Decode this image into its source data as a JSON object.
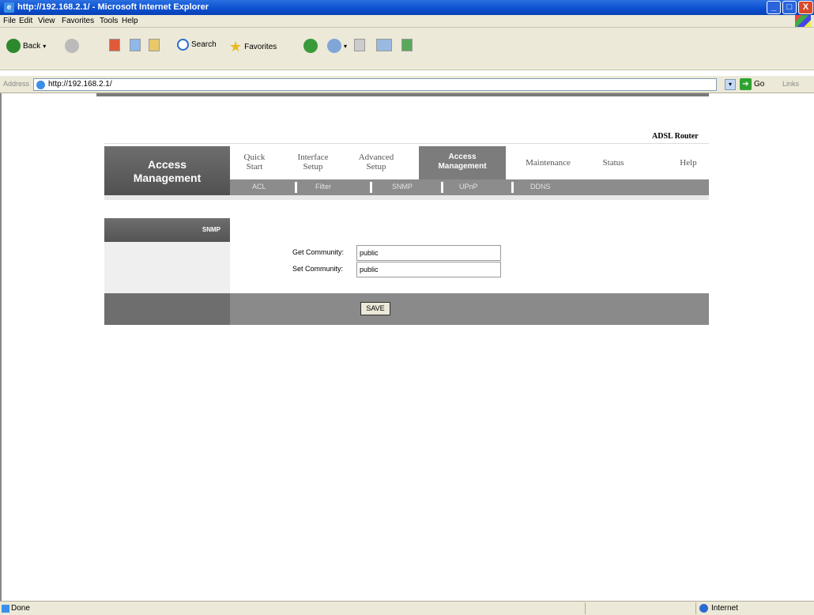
{
  "window": {
    "title": "http://192.168.2.1/ - Microsoft Internet Explorer",
    "min_label": "_",
    "max_label": "□",
    "close_label": "X"
  },
  "menubar": [
    "File",
    "Edit",
    "View",
    "Favorites",
    "Tools",
    "Help"
  ],
  "toolbar": {
    "back_label": "Back",
    "search_label": "Search",
    "favorites_label": "Favorites"
  },
  "address": {
    "label": "Address",
    "url": "http://192.168.2.1/",
    "go_label": "Go",
    "links_label": "Links"
  },
  "router": {
    "brand": "ADSL Router",
    "section_title_line1": "Access",
    "section_title_line2": "Management",
    "tabs": [
      {
        "line1": "Quick",
        "line2": "Start"
      },
      {
        "line1": "Interface",
        "line2": "Setup"
      },
      {
        "line1": "Advanced",
        "line2": "Setup"
      },
      {
        "line1": "Access",
        "line2": "Management",
        "active": true
      },
      {
        "line1": "Maintenance",
        "line2": ""
      },
      {
        "line1": "Status",
        "line2": ""
      },
      {
        "line1": "Help",
        "line2": ""
      }
    ],
    "subtabs": [
      "ACL",
      "Filter",
      "SNMP",
      "UPnP",
      "DDNS"
    ],
    "active_subtab": "SNMP",
    "sidebar_heading": "SNMP",
    "form": {
      "get_community_label": "Get Community",
      "get_community_value": "public",
      "set_community_label": "Set Community",
      "set_community_value": "public"
    },
    "save_label": "SAVE"
  },
  "statusbar": {
    "status": "Done",
    "zone": "Internet"
  }
}
